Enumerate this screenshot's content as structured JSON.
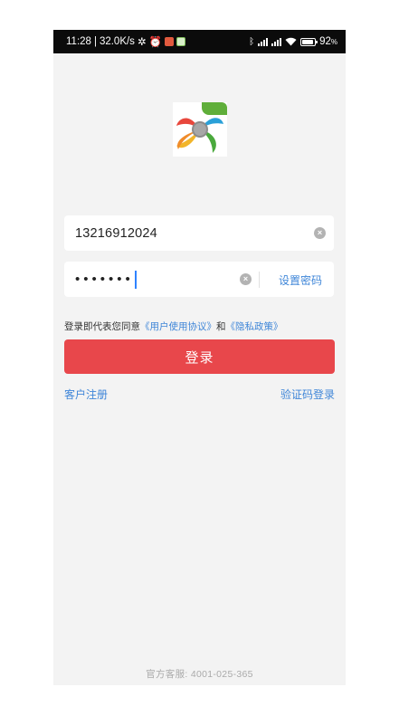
{
  "status_bar": {
    "time": "11:28",
    "speed": "32.0K/s",
    "battery": "92"
  },
  "login": {
    "phone_value": "13216912024",
    "password_dots": "•••••••",
    "set_password_label": "设置密码",
    "agreement_prefix": "登录即代表您同意",
    "user_agreement": "《用户使用协议》",
    "agreement_and": "和",
    "privacy_policy": "《隐私政策》",
    "login_button": "登录",
    "register_link": "客户注册",
    "code_login_link": "验证码登录"
  },
  "footer": {
    "service_label": "官方客服:",
    "service_phone": "4001-025-365"
  },
  "colors": {
    "primary_button": "#e8474b",
    "link": "#3f86d8",
    "background": "#f3f3f3"
  }
}
